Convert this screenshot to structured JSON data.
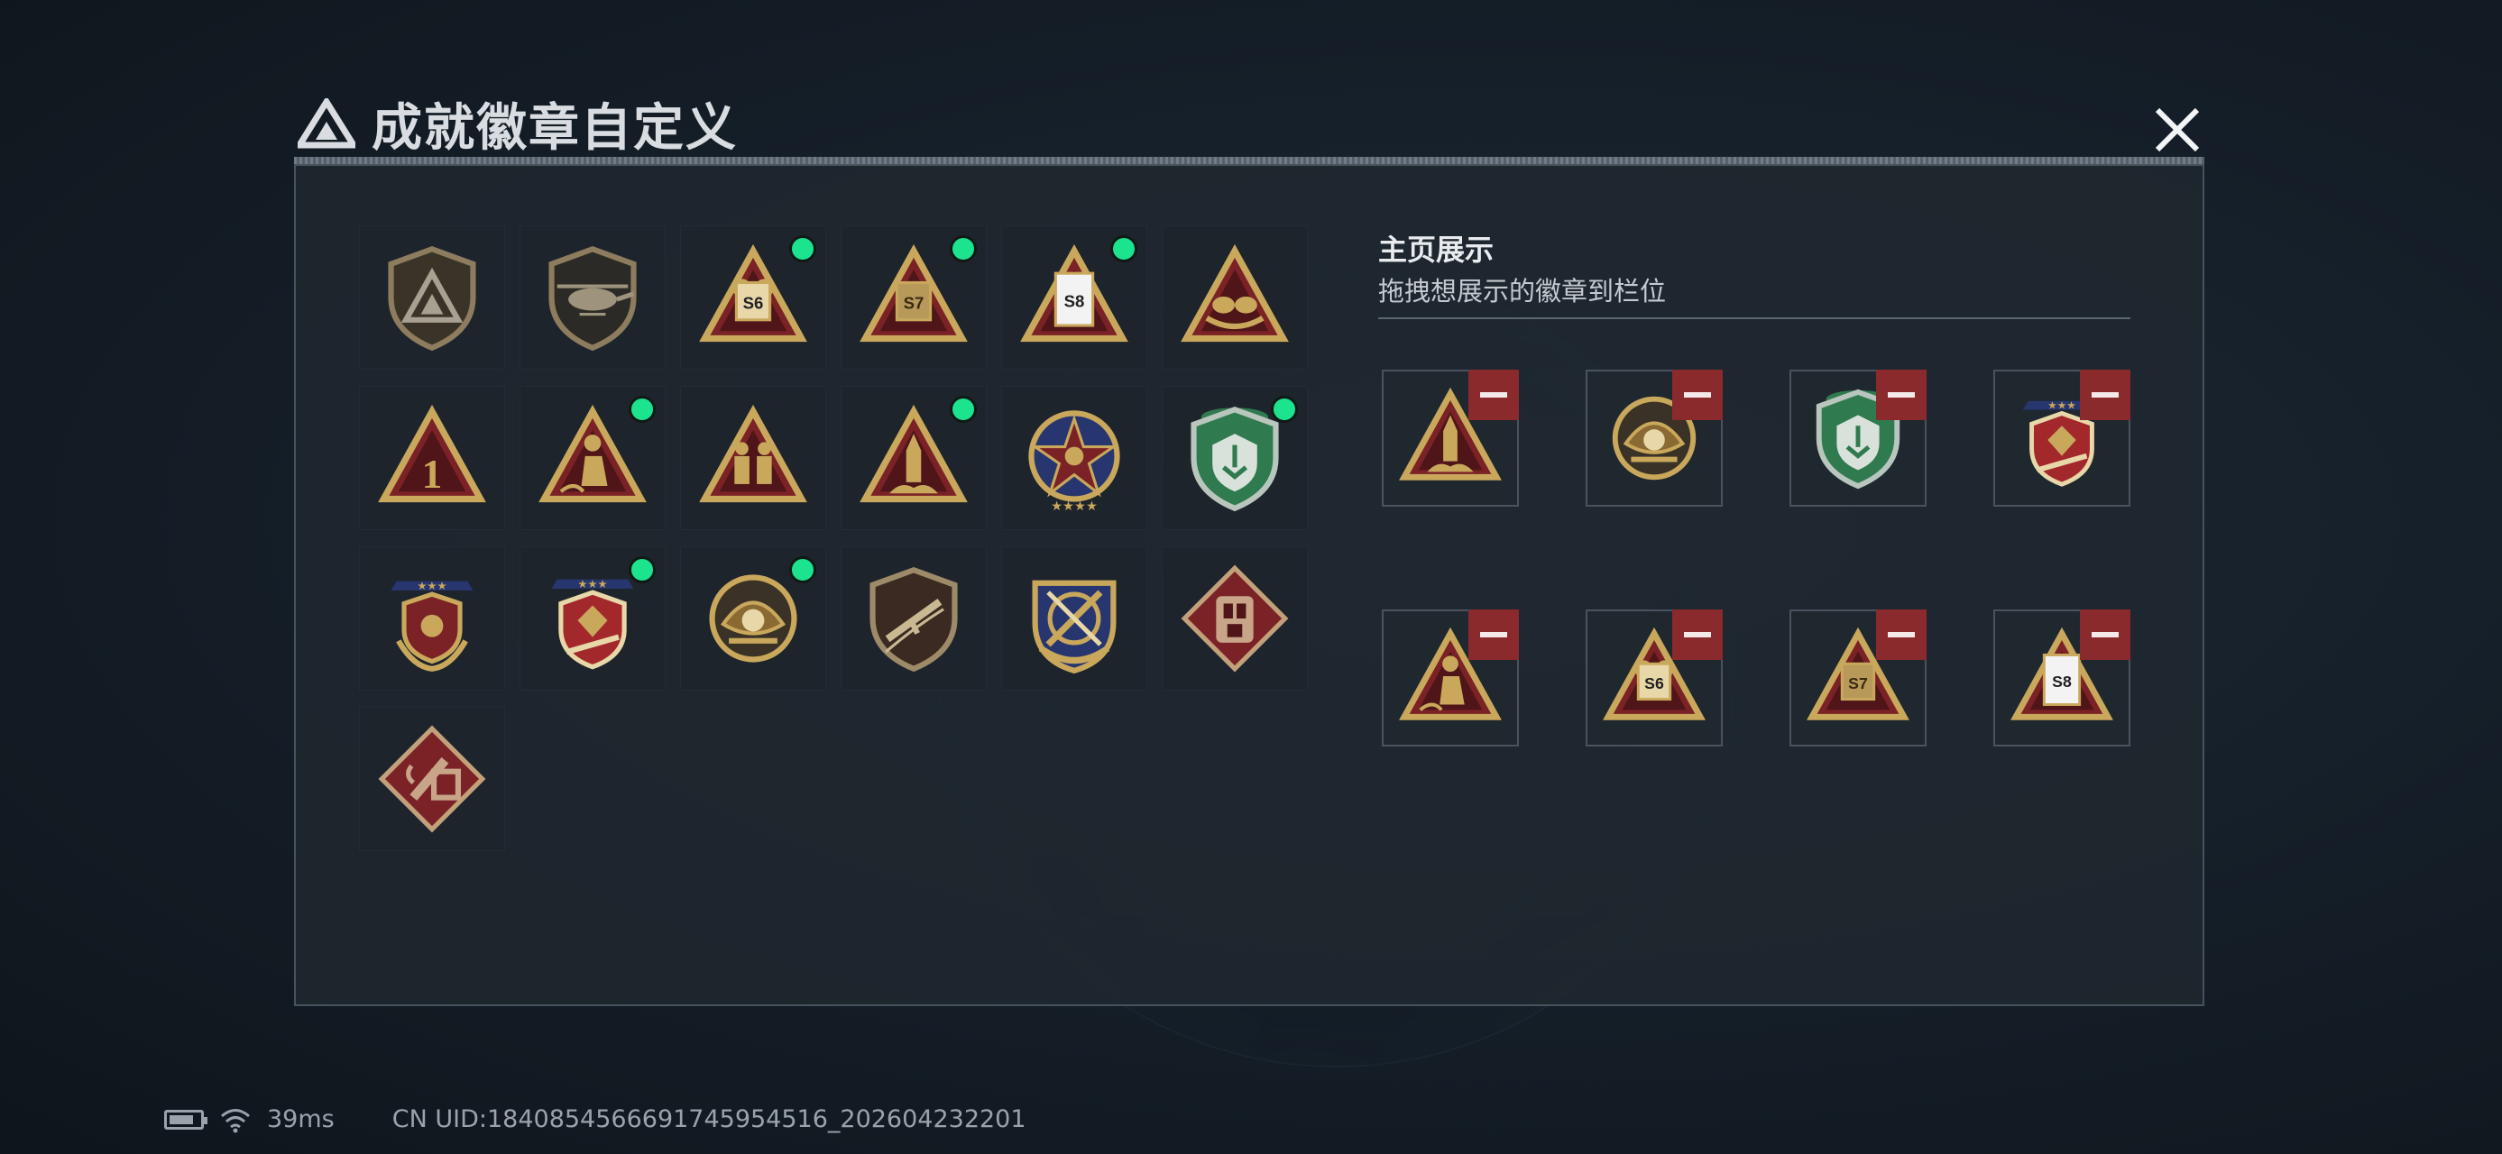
{
  "header": {
    "title": "成就徽章自定义",
    "logo_icon": "triangle-logo-icon",
    "close_icon": "close-icon"
  },
  "collection": {
    "badges": [
      {
        "name": "shield-triangle-badge",
        "new": false
      },
      {
        "name": "helicopter-shield-badge",
        "new": false
      },
      {
        "name": "s6-triangle-badge",
        "new": true
      },
      {
        "name": "s7-triangle-badge",
        "new": true
      },
      {
        "name": "s8-triangle-badge",
        "new": true
      },
      {
        "name": "nest-eggs-triangle-badge",
        "new": false
      },
      {
        "name": "number-one-triangle-badge",
        "new": false
      },
      {
        "name": "kneeling-soldier-triangle-badge",
        "new": true
      },
      {
        "name": "soldiers-triangle-badge",
        "new": false
      },
      {
        "name": "rocket-triangle-badge",
        "new": true
      },
      {
        "name": "star-compass-badge",
        "new": false
      },
      {
        "name": "green-shield-badge",
        "new": true
      },
      {
        "name": "gold-wreath-shield-badge",
        "new": false
      },
      {
        "name": "red-diamond-shield-badge",
        "new": true
      },
      {
        "name": "pearl-shell-badge",
        "new": true
      },
      {
        "name": "rifle-shield-badge",
        "new": false
      },
      {
        "name": "crossed-weapons-crest-badge",
        "new": false
      },
      {
        "name": "vest-diamond-badge",
        "new": false
      },
      {
        "name": "medkit-diamond-badge",
        "new": false
      }
    ]
  },
  "showcase": {
    "title": "主页展示",
    "subtitle": "拖拽想展示的徽章到栏位",
    "slots": [
      {
        "badge": "rocket-triangle-badge"
      },
      {
        "badge": "pearl-shell-badge"
      },
      {
        "badge": "green-shield-badge"
      },
      {
        "badge": "red-diamond-shield-badge"
      },
      {
        "badge": "kneeling-soldier-triangle-badge"
      },
      {
        "badge": "s6-triangle-badge"
      },
      {
        "badge": "s7-triangle-badge"
      },
      {
        "badge": "s8-triangle-badge"
      }
    ]
  },
  "status_bar": {
    "ping": "39ms",
    "uid": "CN UID:1840854566691745954516_202604232201"
  },
  "colors": {
    "accent_green": "#1be38e",
    "remove_red": "#8b2a2c",
    "gold": "#c9a85c",
    "panel": "#202830"
  }
}
